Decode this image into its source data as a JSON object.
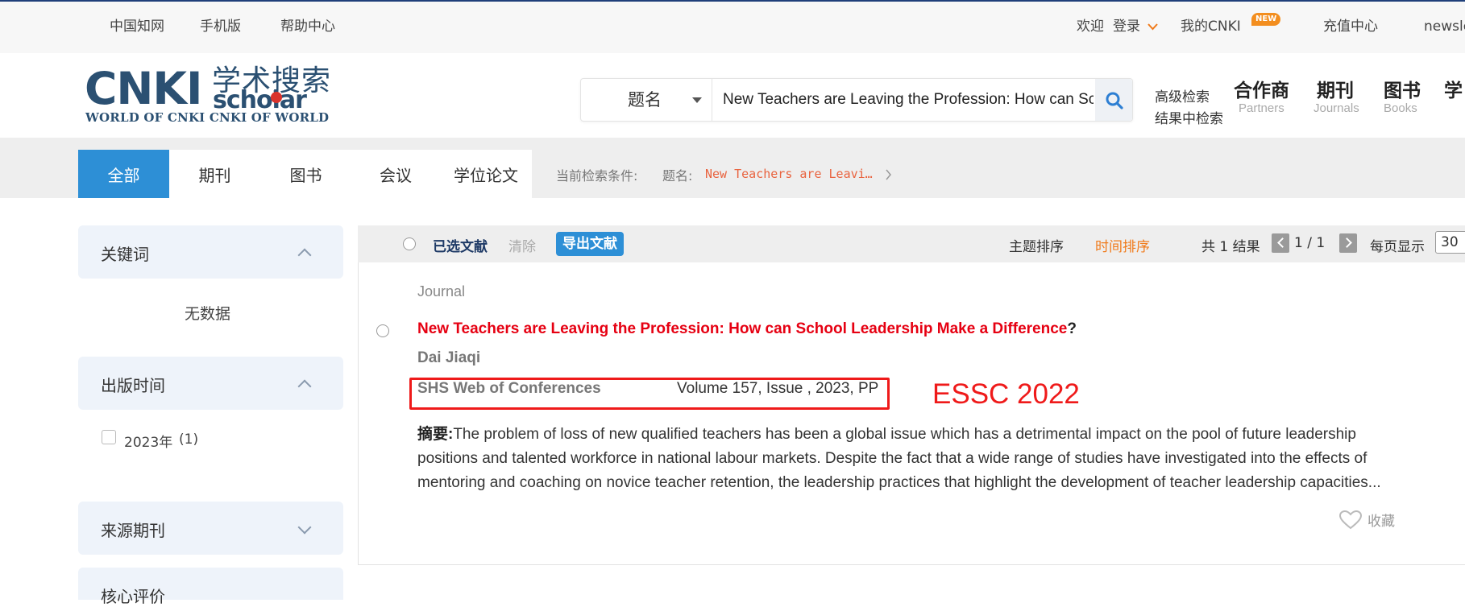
{
  "topbar": {
    "links": [
      "中国知网",
      "手机版",
      "帮助中心"
    ],
    "welcome": "欢迎",
    "login": "登录",
    "my_cnki": "我的CNKI",
    "new_badge": "NEW",
    "recharge": "充值中心",
    "newsletter": "newsle"
  },
  "logo": {
    "word": "CNKI",
    "cn": "学术搜索",
    "scholar": "scholar",
    "tagline": "WORLD OF CNKI CNKI OF WORLD"
  },
  "search": {
    "field": "题名",
    "query": "New Teachers are Leaving the Profession: How can School Leadership Make a Difference?"
  },
  "header_links": {
    "advanced": "高级检索",
    "within": "结果中检索",
    "nav": [
      {
        "cn": "合作商",
        "en": "Partners"
      },
      {
        "cn": "期刊",
        "en": "Journals"
      },
      {
        "cn": "图书",
        "en": "Books"
      },
      {
        "cn": "学",
        "en": ""
      }
    ]
  },
  "tabs": [
    "全部",
    "期刊",
    "图书",
    "会议",
    "学位论文"
  ],
  "conditions": {
    "label": "当前检索条件:",
    "field": "题名:",
    "value": "New Teachers are Leavi…"
  },
  "sidebar": {
    "keyword_title": "关键词",
    "no_data": "无数据",
    "pubtime_title": "出版时间",
    "year_label": "2023年",
    "year_count": "(1)",
    "source_title": "来源期刊",
    "core_title": "核心评价"
  },
  "results_toolbar": {
    "selected": "已选文献",
    "clear": "清除",
    "export": "导出文献",
    "sort_topic": "主题排序",
    "sort_time": "时间排序",
    "total": "共 1 结果",
    "page": "1 / 1",
    "per_page_label": "每页显示",
    "per_page_value": "30"
  },
  "result": {
    "type": "Journal",
    "title": "New Teachers are Leaving the Profession: How can School Leadership Make a Difference",
    "title_end": "?",
    "author": "Dai Jiaqi",
    "source": "SHS Web of Conferences",
    "volume": "Volume 157, Issue , 2023, PP",
    "annotation": "ESSC 2022",
    "abstract_label": "摘要:",
    "abstract": "The problem of loss of new qualified teachers has been a global issue which has a detrimental impact on the pool of future leadership positions and talented workforce in national labour markets. Despite the fact that a wide range of studies have investigated into the effects of mentoring and coaching on novice teacher retention, the leadership practices that highlight the development of teacher leadership capacities...",
    "collect": "收藏"
  },
  "colors": {
    "brand": "#2b5072",
    "accent": "#2d8fd6",
    "title_red": "#e60012",
    "sort_active": "#f07a1a",
    "annotation_red": "#ef1a1a"
  }
}
